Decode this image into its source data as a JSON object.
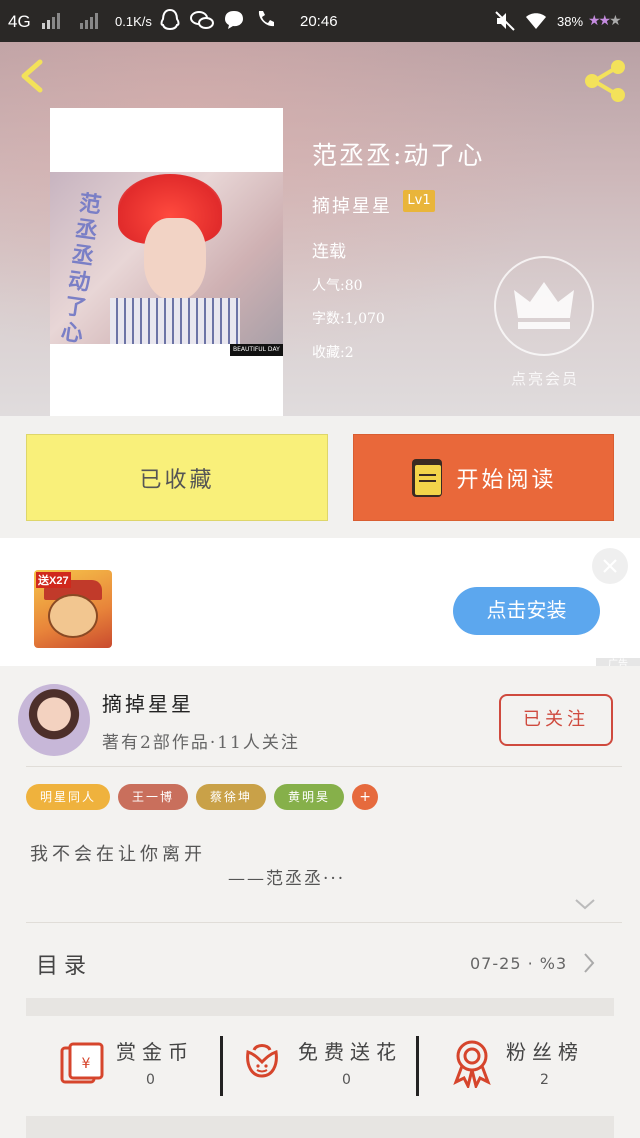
{
  "status_bar": {
    "network": "4G",
    "speed": "0.1K/s",
    "time": "20:46",
    "battery": "38%",
    "icons": [
      "signal-icon",
      "qq-icon",
      "wechat-icon",
      "message-icon",
      "call-icon",
      "mute-icon",
      "wifi-icon",
      "star-rating-icon"
    ]
  },
  "book": {
    "title": "范丞丞:动了心",
    "author": "摘掉星星",
    "level": "Lv1",
    "status": "连载",
    "popularity": "人气:80",
    "word_count": "字数:1,070",
    "favorites": "收藏:2",
    "cover_title": "范丞丞动了心",
    "cover_tag": "BEAUTIFUL DAY"
  },
  "vip": {
    "label": "点亮会员"
  },
  "actions": {
    "favorited_label": "已收藏",
    "read_label": "开始阅读"
  },
  "ad": {
    "badge": "送X27",
    "install_label": "点击安装",
    "ad_tag": "广告"
  },
  "author_card": {
    "name": "摘掉星星",
    "subtitle": "著有2部作品·11人关注",
    "follow_label": "已关注"
  },
  "tags": [
    {
      "label": "明星同人",
      "color": "#efb23d"
    },
    {
      "label": "王一博",
      "color": "#c96f5c"
    },
    {
      "label": "蔡徐坤",
      "color": "#c9a148"
    },
    {
      "label": "黄明昊",
      "color": "#86b04a"
    }
  ],
  "tag_more": "+",
  "intro": {
    "line1": "我不会在让你离开",
    "line2": "——范丞丞···"
  },
  "toc": {
    "label": "目录",
    "info": "07-25 · %3"
  },
  "stats": [
    {
      "label": "赏金币",
      "value": "0",
      "icon": "reward-coin-icon"
    },
    {
      "label": "免费送花",
      "value": "0",
      "icon": "flower-icon"
    },
    {
      "label": "粉丝榜",
      "value": "2",
      "icon": "fan-badge-icon"
    }
  ],
  "colors": {
    "accent_orange": "#e9683a",
    "fav_yellow": "#f9f07a",
    "follow_red": "#cf4a3e",
    "install_blue": "#5ca7ee"
  }
}
